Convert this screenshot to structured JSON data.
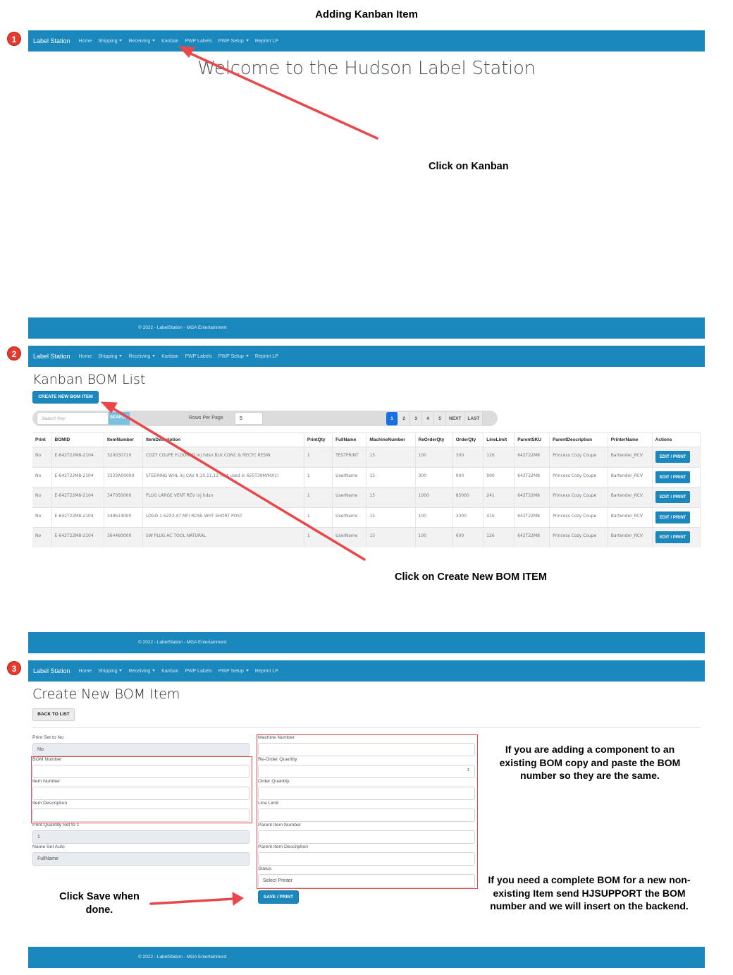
{
  "doc_title": "Adding Kanban Item",
  "nav": {
    "brand": "Label Station",
    "links": [
      "Home",
      "Shipping",
      "Receiving",
      "Kanban",
      "PWP Labels",
      "PWP Setup",
      "Reprint LP"
    ]
  },
  "footer_text": "© 2022 - LabelStation - MGA Entertainment",
  "steps": [
    "1",
    "2",
    "3"
  ],
  "step1": {
    "welcome": "Welcome to the Hudson Label Station",
    "callout": "Click on Kanban"
  },
  "step2": {
    "title": "Kanban BOM List",
    "create_button": "CREATE NEW BOM ITEM",
    "search_placeholder": "Search Key",
    "search_button": "SEARCH",
    "rows_per_page_label": "Rows Per Page",
    "rows_per_page_value": "5",
    "pages": [
      "1",
      "2",
      "3",
      "4",
      "5",
      "NEXT",
      "LAST"
    ],
    "active_page": "1",
    "callout": "Click on Create New BOM ITEM",
    "columns": [
      "Print",
      "BOMID",
      "ItemNumber",
      "ItemDescription",
      "PrintQty",
      "FullName",
      "MachineNumber",
      "ReOrderQty",
      "OrderQty",
      "LineLimit",
      "ParentSKU",
      "ParentDescription",
      "PrinterName",
      "Actions"
    ],
    "rows": [
      [
        "No",
        "E-642T22M8-2104",
        "320030710",
        "COZY COUPE FLOORBD inj hdsn BLK CONC & RECYC RESIN",
        "1",
        "TESTPRINT",
        "15",
        "100",
        "300",
        "126",
        "642T22M8",
        "Princess Cozy Coupe",
        "Bartender_RCV"
      ],
      [
        "No",
        "E-642T22M8-2104",
        "3333A00000",
        "STEERING WHL inj CAV 9,10,11,12 (not used in 655T39M/MX1)",
        "1",
        "UserName",
        "15",
        "300",
        "900",
        "900",
        "642T22M8",
        "Princess Cozy Coupe",
        "Bartender_RCV"
      ],
      [
        "No",
        "E-642T22M8-2104",
        "347050000",
        "PLUG LARGE VENT REV inj hdsn",
        "1",
        "UserName",
        "15",
        "1000",
        "85000",
        "241",
        "642T22M8",
        "Princess Cozy Coupe",
        "Bartender_RCV"
      ],
      [
        "No",
        "E-642T22M8-2104",
        "349614000",
        "LOGO 1.62X3.47 MFI ROSE WHT SHORT POST",
        "1",
        "UserName",
        "15",
        "100",
        "3300",
        "415",
        "642T22M8",
        "Princess Cozy Coupe",
        "Bartender_RCV"
      ],
      [
        "No",
        "E-642T22M8-2104",
        "364460000",
        "SW PLUG AC TOOL NATURAL",
        "1",
        "UserName",
        "15",
        "100",
        "600",
        "126",
        "642T22M8",
        "Princess Cozy Coupe",
        "Bartender_RCV"
      ]
    ],
    "row_action": "EDIT / PRINT"
  },
  "step3": {
    "title": "Create New BOM Item",
    "back_button": "BACK TO LIST",
    "print_label": "Print Set to No",
    "print_value": "No",
    "bom_number_label": "BOM Number",
    "item_number_label": "Item Number",
    "item_description_label": "Item Description",
    "print_qty_label": "Print Quantity Set to 1",
    "print_qty_value": "1",
    "name_label": "Name Set Auto",
    "name_value": "FullName",
    "machine_number_label": "Machine Number",
    "reorder_qty_label": "Re-Order Quantity",
    "order_qty_label": "Order Quantity",
    "line_limit_label": "Line Limit",
    "parent_item_number_label": "Parent Item Number",
    "parent_item_description_label": "Parent Item Description",
    "status_label": "Status",
    "status_value": "Select Printer",
    "save_button": "SAVE / PRINT",
    "callout_save": "Click Save when done.",
    "callout_existing": "If you are adding a component to an existing BOM copy and paste the BOM number so they are the same.",
    "callout_new": "If you need a complete BOM for a new non-existing Item send HJSUPPORT the BOM number and we will insert on the backend."
  },
  "colors": {
    "nav_blue": "#1a88bd",
    "arrow_red": "#e8484a",
    "badge_red": "#e8392f",
    "active_page_blue": "#1a6fe0"
  }
}
